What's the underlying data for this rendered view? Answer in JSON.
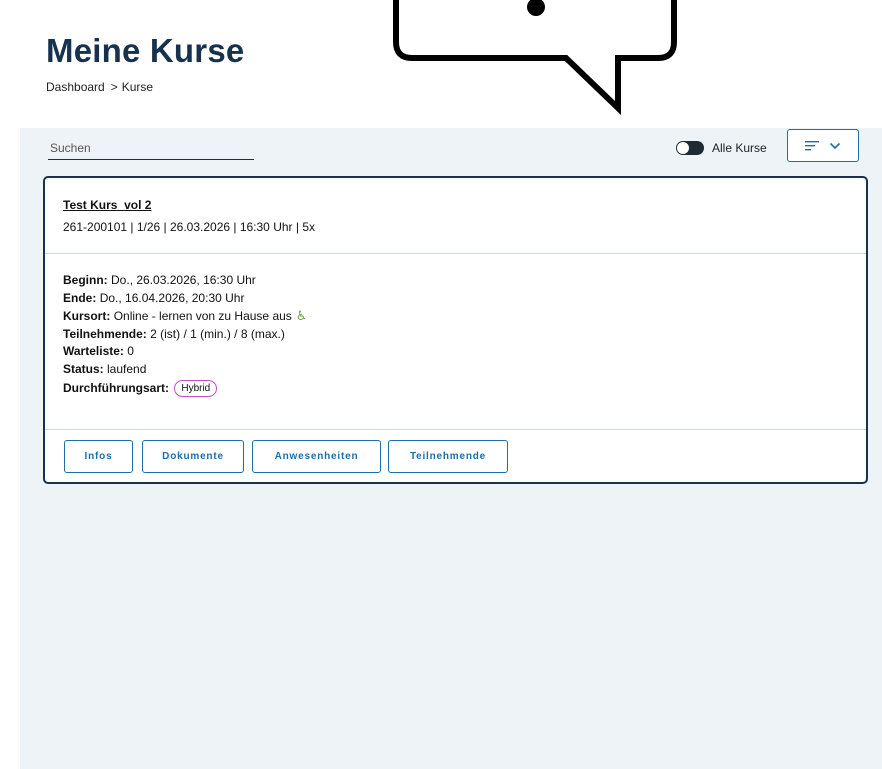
{
  "header": {
    "title": "Meine Kurse",
    "breadcrumb": {
      "home": "Dashboard",
      "separator": ">",
      "current": "Kurse"
    }
  },
  "toolbar": {
    "search_placeholder": "Suchen",
    "toggle_label": "Alle Kurse",
    "toggle_on": false,
    "sort_icon": "sort-lines-icon",
    "dropdown_icon": "chevron-down-icon"
  },
  "course": {
    "title": "Test Kurs_vol 2",
    "subtitle": "261-200101 | 1/26 | 26.03.2026 | 16:30 Uhr | 5x",
    "details": {
      "begin_label": "Beginn:",
      "begin_value": "Do., 26.03.2026, 16:30 Uhr",
      "end_label": "Ende:",
      "end_value": "Do., 16.04.2026, 20:30 Uhr",
      "location_label": "Kursort:",
      "location_value": "Online - lernen von zu Hause aus",
      "accessibility_icon": "wheelchair-icon",
      "participants_label": "Teilnehmende:",
      "participants_value": "2 (ist) / 1 (min.) / 8 (max.)",
      "waitlist_label": "Warteliste:",
      "waitlist_value": "0",
      "status_label": "Status:",
      "status_value": "laufend",
      "mode_label": "Durchführungsart:",
      "mode_badge": "Hybrid"
    },
    "actions": {
      "infos": "Infos",
      "documents": "Dokumente",
      "attendance": "Anwesenheiten",
      "participants": "Teilnehmende"
    }
  },
  "colors": {
    "title": "#17324d",
    "accent": "#1b6fa8",
    "badge_border": "#c34fc9",
    "accessibility": "#6aa43a",
    "background": "#eef3f7"
  }
}
